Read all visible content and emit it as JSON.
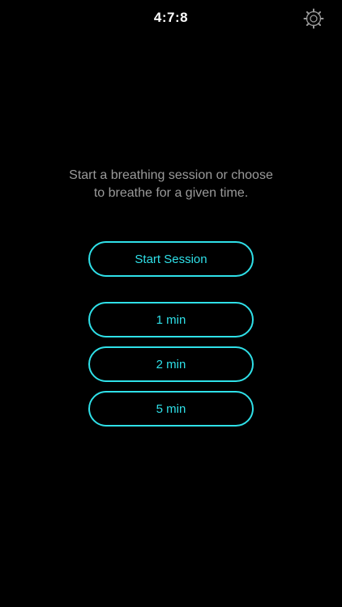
{
  "header": {
    "title": "4:7:8",
    "settings_icon": "gear-icon"
  },
  "main": {
    "intro_text": "Start a breathing session or choose to breathe for a given time.",
    "start_button_label": "Start Session",
    "duration_options": [
      {
        "label": "1 min"
      },
      {
        "label": "2 min"
      },
      {
        "label": "5 min"
      }
    ]
  },
  "colors": {
    "background": "#000000",
    "accent": "#2fe0e8",
    "text_muted": "#9a9a9a",
    "title": "#ffffff"
  }
}
